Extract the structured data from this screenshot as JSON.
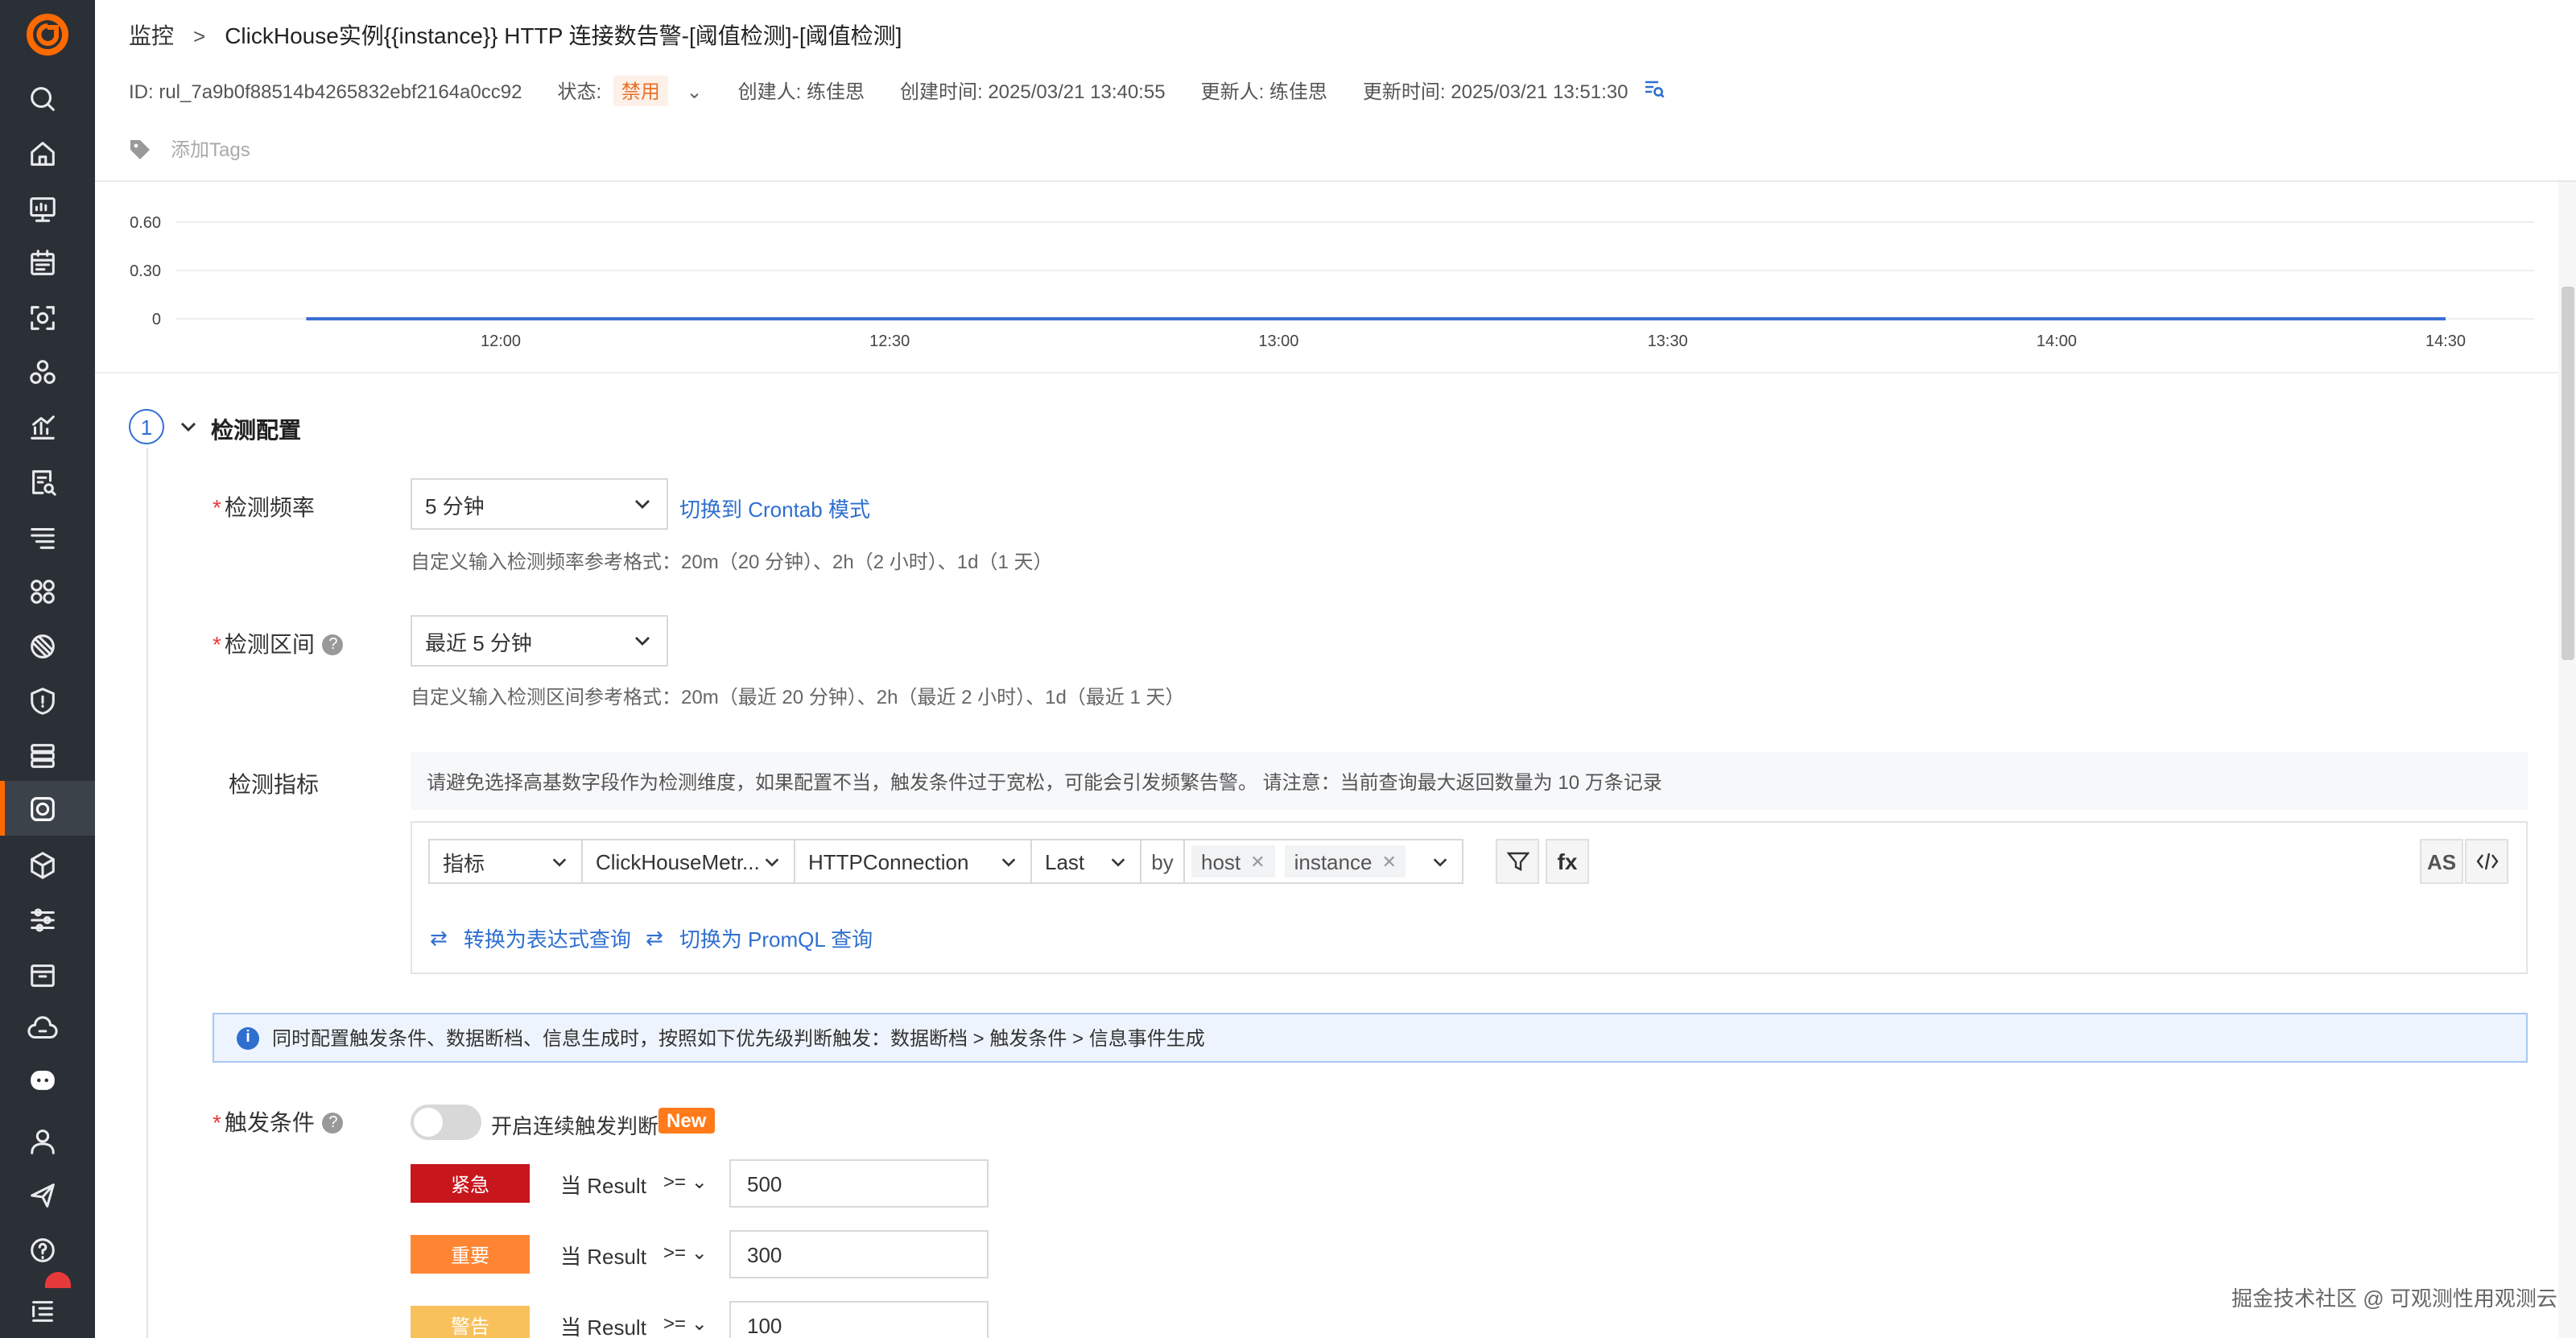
{
  "breadcrumb": {
    "root": "监控",
    "title": "ClickHouse实例{{instance}} HTTP 连接数告警-[阈值检测]-[阈值检测]"
  },
  "meta": {
    "id": "ID: rul_7a9b0f88514b4265832ebf2164a0cc92",
    "status_label": "状态:",
    "status_value": "禁用",
    "creator": "创建人: 练佳思",
    "created_at": "创建时间: 2025/03/21 13:40:55",
    "updater": "更新人: 练佳思",
    "updated_at": "更新时间: 2025/03/21 13:51:30"
  },
  "tags": {
    "placeholder": "添加Tags"
  },
  "chart_data": {
    "type": "line",
    "y_ticks": [
      "0.60",
      "0.30",
      "0"
    ],
    "x_ticks": [
      "12:00",
      "12:30",
      "13:00",
      "13:30",
      "14:00",
      "14:30"
    ],
    "ylim": [
      0,
      0.6
    ],
    "grid": true,
    "series_color": "#3b6fd4",
    "x": [
      "11:45",
      "14:30"
    ],
    "values": [
      0,
      0
    ]
  },
  "section": {
    "step": "1",
    "title": "检测配置"
  },
  "frequency": {
    "label": "检测频率",
    "value": "5 分钟",
    "switch_link": "切换到 Crontab 模式",
    "hint": "自定义输入检测频率参考格式：20m（20 分钟）、2h（2 小时）、1d（1 天）"
  },
  "interval": {
    "label": "检测区间",
    "value": "最近 5 分钟",
    "hint": "自定义输入检测区间参考格式：20m（最近 20 分钟）、2h（最近 2 小时）、1d（最近 1 天）"
  },
  "metric": {
    "label": "检测指标",
    "warning": "请避免选择高基数字段作为检测维度，如果配置不当，触发条件过于宽松，可能会引发频繁告警。 请注意：当前查询最大返回数量为 10 万条记录",
    "type": "指标",
    "measurement": "ClickHouseMetr...",
    "field": "HTTPConnection",
    "func": "Last",
    "by": "by",
    "group_tags": [
      "host",
      "instance"
    ],
    "fx": "fx",
    "as": "AS",
    "to_expression": "转换为表达式查询",
    "to_promql": "切换为 PromQL 查询"
  },
  "info": "同时配置触发条件、数据断档、信息生成时，按照如下优先级判断触发：数据断档 > 触发条件 > 信息事件生成",
  "trigger": {
    "label": "触发条件",
    "toggle_text": "开启连续触发判断",
    "new_badge": "New",
    "levels": [
      {
        "name": "紧急",
        "color": "#c8161d",
        "cond": "当 Result",
        "op": ">=",
        "value": "500"
      },
      {
        "name": "重要",
        "color": "#ff8533",
        "cond": "当 Result",
        "op": ">=",
        "value": "300"
      },
      {
        "name": "警告",
        "color": "#f8c15c",
        "cond": "当 Result",
        "op": ">=",
        "value": "100"
      }
    ]
  },
  "watermark": "掘金技术社区 @ 可观测性用观测云",
  "sidebar": {
    "icons": [
      "search-icon",
      "home-icon",
      "monitor-screen-icon",
      "calendar-icon",
      "scan-icon",
      "cluster-icon",
      "chart-icon",
      "log-search-icon",
      "list-filter-icon",
      "apps-icon",
      "rum-icon",
      "security-icon",
      "server-icon",
      "alarm-icon",
      "cube-icon",
      "settings-sliders-icon",
      "box-icon",
      "cloud-sync-icon",
      "robot-icon",
      "user-icon",
      "send-icon",
      "help-icon",
      "menu-list-icon"
    ]
  }
}
